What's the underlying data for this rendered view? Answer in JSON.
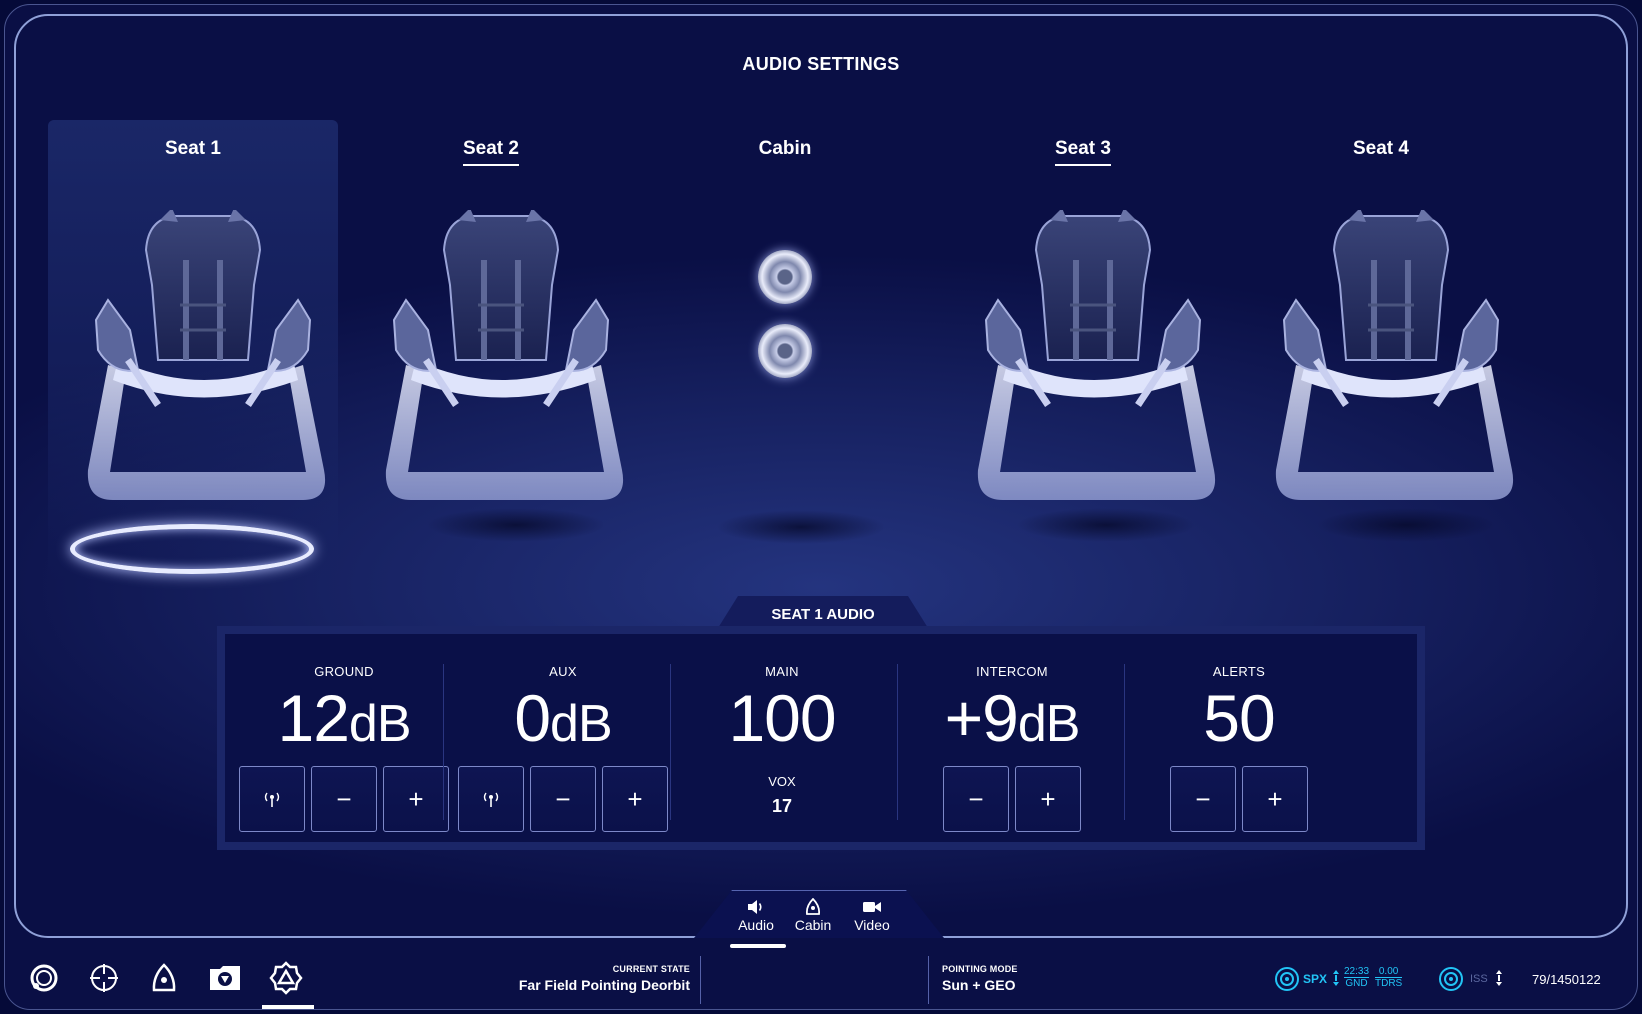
{
  "page_title": "AUDIO SETTINGS",
  "seats": [
    {
      "label": "Seat 1",
      "selected": true,
      "underlined": false
    },
    {
      "label": "Seat 2",
      "selected": false,
      "underlined": true
    },
    {
      "label": "Cabin",
      "selected": false,
      "underlined": false
    },
    {
      "label": "Seat 3",
      "selected": false,
      "underlined": true
    },
    {
      "label": "Seat 4",
      "selected": false,
      "underlined": false
    }
  ],
  "audio_panel": {
    "title": "SEAT 1 AUDIO",
    "channels": {
      "ground": {
        "label": "GROUND",
        "value": "12",
        "unit": "dB"
      },
      "aux": {
        "label": "AUX",
        "value": "0",
        "unit": "dB"
      },
      "main": {
        "label": "MAIN",
        "value": "100",
        "vox_label": "VOX",
        "vox_value": "17"
      },
      "intercom": {
        "label": "INTERCOM",
        "value": "+9",
        "unit": "dB"
      },
      "alerts": {
        "label": "ALERTS",
        "value": "50"
      }
    },
    "minus_symbol": "−",
    "plus_symbol": "+"
  },
  "view_tabs": [
    {
      "label": "Audio",
      "icon": "speaker-icon",
      "active": true
    },
    {
      "label": "Cabin",
      "icon": "capsule-icon",
      "active": false
    },
    {
      "label": "Video",
      "icon": "video-camera-icon",
      "active": false
    }
  ],
  "bottom_nav": [
    {
      "icon": "circle-ring-icon"
    },
    {
      "icon": "crosshair-icon"
    },
    {
      "icon": "capsule-icon"
    },
    {
      "icon": "folder-icon"
    },
    {
      "icon": "settings-gear-icon",
      "active": true
    }
  ],
  "status": {
    "current_state_label": "CURRENT STATE",
    "current_state_value": "Far Field Pointing Deorbit",
    "pointing_mode_label": "POINTING MODE",
    "pointing_mode_value": "Sun + GEO",
    "spx_label": "SPX",
    "gnd_time": "22:33",
    "gnd_label": "GND",
    "tdrs_value": "0.00",
    "tdrs_label": "TDRS",
    "iss_label": "ISS",
    "counter": "79/1450122"
  },
  "colors": {
    "background": "#0a0f45",
    "panel": "#1b2668",
    "accent_cyan": "#22c4f5",
    "text": "#ffffff"
  }
}
